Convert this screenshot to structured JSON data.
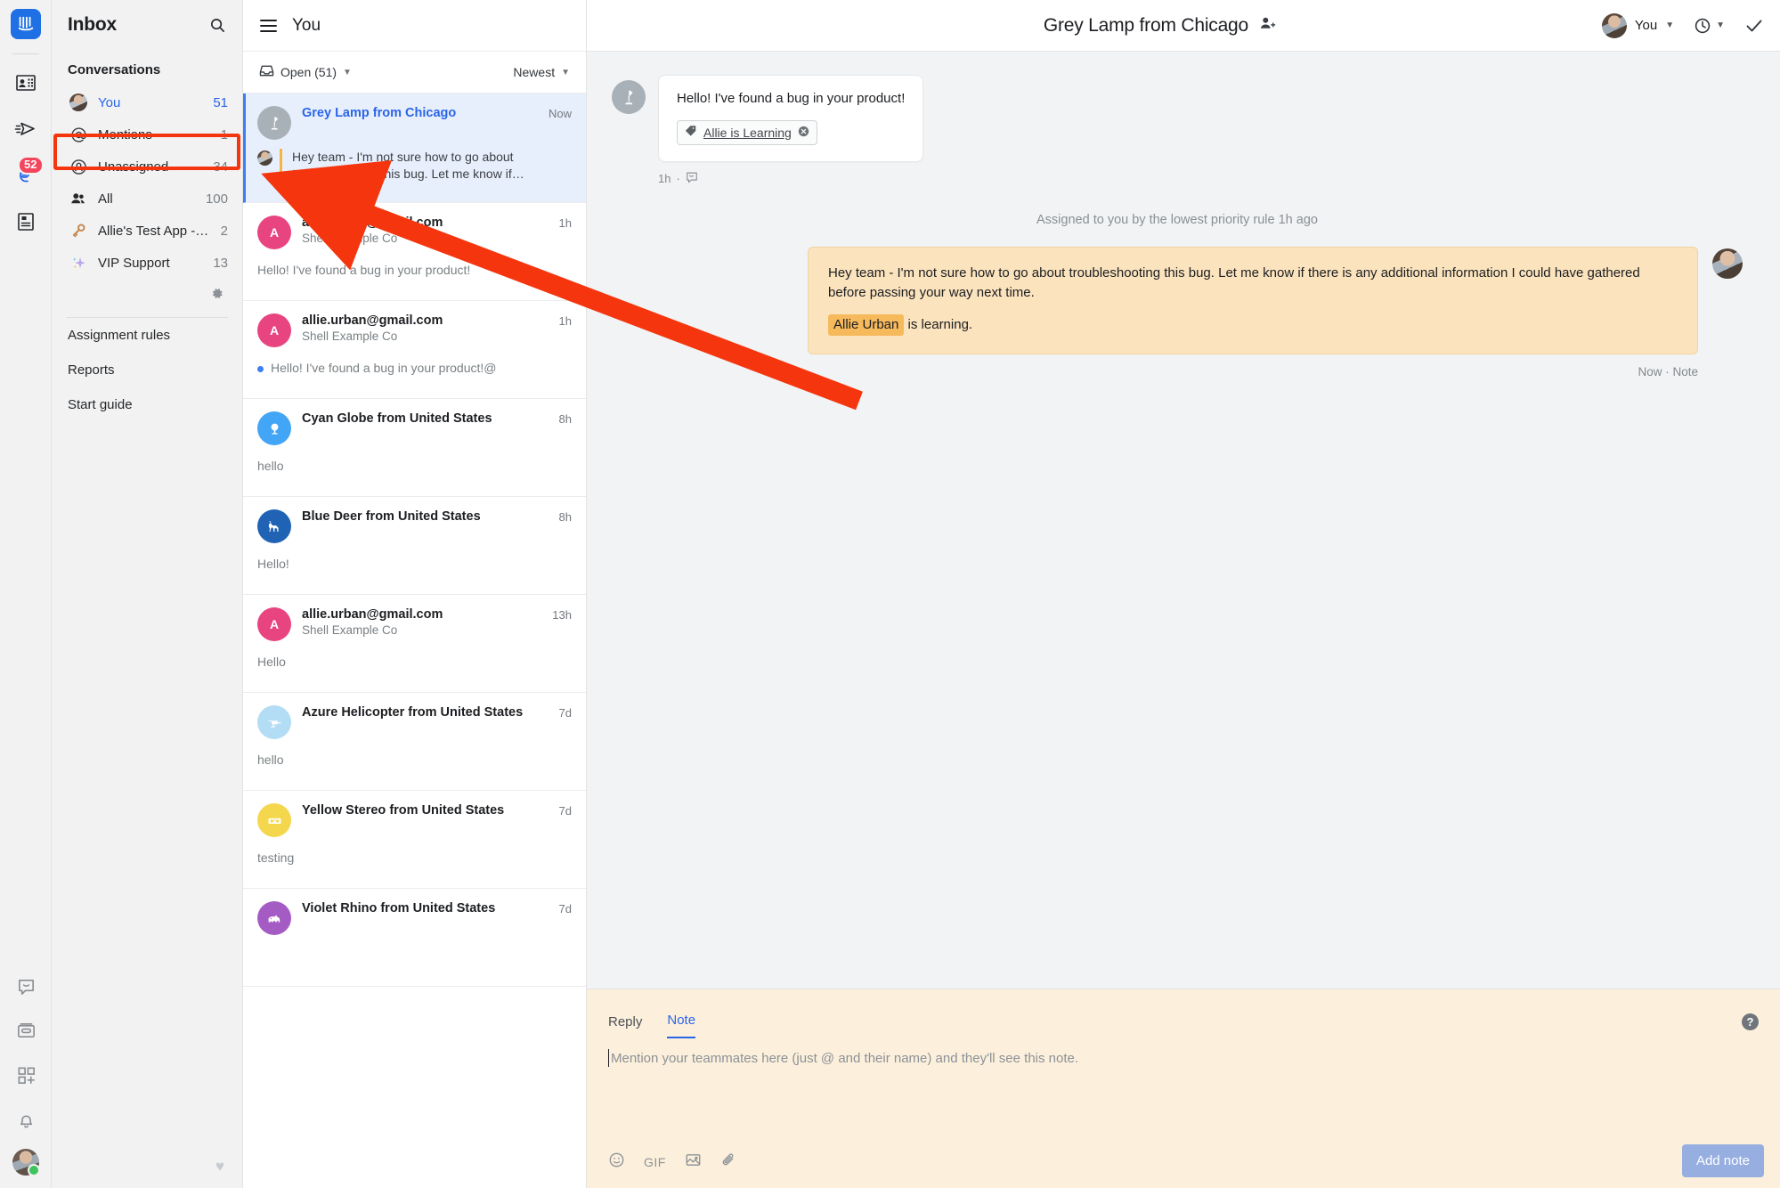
{
  "rail": {
    "logo": "intercom-logo",
    "items": [
      {
        "name": "contacts-icon",
        "badge": null
      },
      {
        "name": "outbound-icon",
        "badge": null
      },
      {
        "name": "inbox-conversations-icon",
        "badge": "52"
      },
      {
        "name": "articles-icon",
        "badge": null
      }
    ],
    "bottom_items": [
      {
        "name": "messenger-icon"
      },
      {
        "name": "news-icon"
      },
      {
        "name": "apps-add-icon"
      },
      {
        "name": "bell-icon"
      }
    ]
  },
  "sidebar": {
    "title": "Inbox",
    "search_icon": "search-icon",
    "section_label": "Conversations",
    "items": [
      {
        "icon": "avatar-icon",
        "label": "You",
        "count": "51",
        "active": true
      },
      {
        "icon": "at-icon",
        "label": "Mentions",
        "count": "1",
        "active": false
      },
      {
        "icon": "unassigned-icon",
        "label": "Unassigned",
        "count": "34",
        "active": false
      },
      {
        "icon": "people-icon",
        "label": "All",
        "count": "100",
        "active": false
      },
      {
        "icon": "key-icon",
        "label": "Allie's Test App -…",
        "count": "2",
        "active": false
      },
      {
        "icon": "sparkle-icon",
        "label": "VIP Support",
        "count": "13",
        "active": false
      }
    ],
    "gear_icon": "gear-icon",
    "links": [
      "Assignment rules",
      "Reports",
      "Start guide"
    ],
    "heart_icon": "heart-icon"
  },
  "conversation_list": {
    "burger_icon": "hamburger-icon",
    "title": "You",
    "filter_icon": "inbox-icon",
    "filter_label": "Open (51)",
    "sort_label": "Newest",
    "items": [
      {
        "name": "Grey Lamp from Chicago",
        "company": "",
        "time": "Now",
        "avatar_letter": "",
        "avatar_icon": "lamp-icon",
        "avatar_color": "#a8b0b8",
        "preview": "",
        "note_preview": "Hey team - I'm not sure how to go about troubleshooting this bug. Let me know if…",
        "selected": true,
        "unread": false
      },
      {
        "name": "allie.urban@gmail.com",
        "company": "Shell Example Co",
        "time": "1h",
        "avatar_letter": "A",
        "avatar_icon": "",
        "avatar_color": "#e8447f",
        "preview": "Hello! I've found a bug in your product!",
        "note_preview": "",
        "selected": false,
        "unread": false
      },
      {
        "name": "allie.urban@gmail.com",
        "company": "Shell Example Co",
        "time": "1h",
        "avatar_letter": "A",
        "avatar_icon": "",
        "avatar_color": "#e8447f",
        "preview": "Hello! I've found a bug in your product!@",
        "note_preview": "",
        "selected": false,
        "unread": true
      },
      {
        "name": "Cyan Globe from United States",
        "company": "",
        "time": "8h",
        "avatar_letter": "",
        "avatar_icon": "globe-icon",
        "avatar_color": "#42a5f5",
        "preview": "hello",
        "note_preview": "",
        "selected": false,
        "unread": false
      },
      {
        "name": "Blue Deer from United States",
        "company": "",
        "time": "8h",
        "avatar_letter": "",
        "avatar_icon": "deer-icon",
        "avatar_color": "#2063b5",
        "preview": "Hello!",
        "note_preview": "",
        "selected": false,
        "unread": false
      },
      {
        "name": "allie.urban@gmail.com",
        "company": "Shell Example Co",
        "time": "13h",
        "avatar_letter": "A",
        "avatar_icon": "",
        "avatar_color": "#e8447f",
        "preview": "Hello",
        "note_preview": "",
        "selected": false,
        "unread": false
      },
      {
        "name": "Azure Helicopter from United States",
        "company": "",
        "time": "7d",
        "avatar_letter": "",
        "avatar_icon": "helicopter-icon",
        "avatar_color": "#b3dcf5",
        "preview": "hello",
        "note_preview": "",
        "selected": false,
        "unread": false
      },
      {
        "name": "Yellow Stereo from United States",
        "company": "",
        "time": "7d",
        "avatar_letter": "",
        "avatar_icon": "stereo-icon",
        "avatar_color": "#f5d74e",
        "preview": "testing",
        "note_preview": "",
        "selected": false,
        "unread": false
      },
      {
        "name": "Violet Rhino from United States",
        "company": "",
        "time": "7d",
        "avatar_letter": "",
        "avatar_icon": "rhino-icon",
        "avatar_color": "#a45cc4",
        "preview": "",
        "note_preview": "",
        "selected": false,
        "unread": false
      }
    ]
  },
  "main": {
    "title": "Grey Lamp from Chicago",
    "add_participant_icon": "add-person-icon",
    "assignee_label": "You",
    "assignee_caret": "▾",
    "snooze_icon": "clock-icon",
    "close_icon": "check-icon",
    "incoming_message": {
      "text": "Hello! I've found a bug in your product!",
      "tag_icon": "tag-icon",
      "tag_label": "Allie is Learning",
      "tag_remove_icon": "remove-tag-icon",
      "meta_time": "1h",
      "meta_icon": "messenger-channel-icon"
    },
    "system_note": "Assigned to you by the lowest priority rule 1h ago",
    "note": {
      "text_before": "Hey team - I'm not sure how to go about troubleshooting this bug. Let me know if there is any additional information I could have gathered before passing your way next time.",
      "mention": "Allie Urban",
      "text_after": "is learning.",
      "meta": "Now · Note"
    }
  },
  "composer": {
    "tabs": [
      {
        "label": "Reply",
        "active": false
      },
      {
        "label": "Note",
        "active": true
      }
    ],
    "help_icon": "help-icon",
    "placeholder": "Mention your teammates here (just @ and their name) and they'll see this note.",
    "tools": [
      {
        "name": "emoji-icon",
        "label": ""
      },
      {
        "name": "gif-icon",
        "label": "GIF"
      },
      {
        "name": "image-icon",
        "label": ""
      },
      {
        "name": "attachment-icon",
        "label": ""
      }
    ],
    "submit_label": "Add note"
  },
  "annotation": {
    "highlight_color": "#f4350e",
    "target": "Mentions"
  }
}
